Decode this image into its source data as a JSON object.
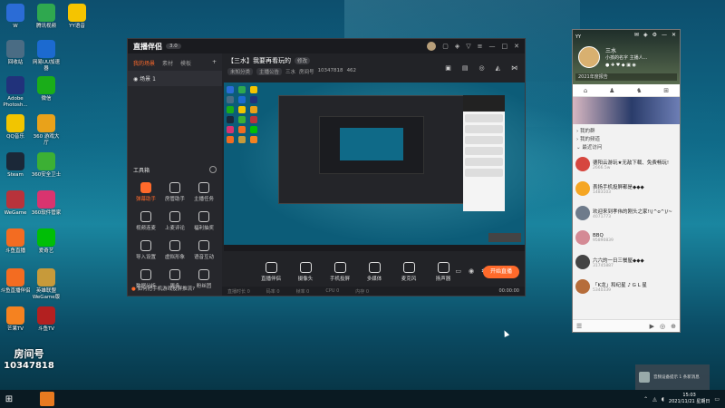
{
  "desktop": {
    "icons": [
      {
        "label": "W",
        "color": "#2b6cd6"
      },
      {
        "label": "腾讯视频",
        "color": "#2fa84f"
      },
      {
        "label": "YY语音",
        "color": "#f5c400"
      },
      {
        "label": "回收站",
        "color": "#4a6c84"
      },
      {
        "label": "网易UU加速器",
        "color": "#1c6ad0"
      },
      {
        "label": "Adobe Photosh...",
        "color": "#21327b"
      },
      {
        "label": "微信",
        "color": "#1aad19"
      },
      {
        "label": "QQ音乐",
        "color": "#f2c500"
      },
      {
        "label": "360 游戏大厅",
        "color": "#e9a21a"
      },
      {
        "label": "Steam",
        "color": "#1b2838"
      },
      {
        "label": "360安全卫士",
        "color": "#3cb034"
      },
      {
        "label": "WeGame",
        "color": "#b8333b"
      },
      {
        "label": "360软件管家",
        "color": "#d9346f"
      },
      {
        "label": "斗鱼直播",
        "color": "#f36c21"
      },
      {
        "label": "爱奇艺",
        "color": "#00be06"
      },
      {
        "label": "斗鱼直播伴侣",
        "color": "#f36c21"
      },
      {
        "label": "英雄联盟 WeGame版",
        "color": "#c79a3a"
      },
      {
        "label": "芒果TV",
        "color": "#f58220"
      },
      {
        "label": "斗鱼TV",
        "color": "#b32020"
      }
    ],
    "room_label": "房间号",
    "room_number": "10347818"
  },
  "app": {
    "logo": "直播伴侣",
    "version": "3.0",
    "sidebar": {
      "tabs": [
        "我的场景",
        "素材",
        "模板"
      ],
      "plus": "+",
      "scene": "场景 1",
      "tools_title": "工具箱",
      "tools": [
        {
          "label": "弹幕助手",
          "hot": true
        },
        {
          "label": "房管助手",
          "hot": false
        },
        {
          "label": "主播任务",
          "hot": false
        },
        {
          "label": "视频连麦",
          "hot": false
        },
        {
          "label": "上麦评论",
          "hot": false
        },
        {
          "label": "福利抽奖",
          "hot": false
        },
        {
          "label": "导入设置",
          "hot": false
        },
        {
          "label": "虚拟形象",
          "hot": false
        },
        {
          "label": "语音互动",
          "hot": false
        },
        {
          "label": "数据分析",
          "hot": false
        },
        {
          "label": "更多",
          "hot": false
        },
        {
          "label": "粉丝团",
          "hot": false
        }
      ],
      "tip": "如何把手机游戏投屏推流?"
    },
    "main": {
      "title": "【三水】我要再看玩的",
      "edit_label": "修改",
      "tags": [
        "未知分类",
        "主播公告",
        "三水",
        "房间号"
      ],
      "room_no": "10347818",
      "viewers": "462",
      "controls": [
        {
          "label": "直播伴侣"
        },
        {
          "label": "摄像头"
        },
        {
          "label": "手机投屏"
        },
        {
          "label": "多媒体"
        },
        {
          "label": "麦克风"
        },
        {
          "label": "扬声器"
        }
      ],
      "live_button": "开始直播",
      "status": [
        "直播时长 0",
        "码率 0",
        "帧率 0",
        "CPU 0",
        "内存 0"
      ],
      "time": "00:00:00"
    }
  },
  "chat_panel": {
    "app_tag": "YY",
    "name": "三水",
    "signature": "小孩的名字 主播人...",
    "search_placeholder": "2021年度报告",
    "groups": [
      "我的群",
      "我的频道",
      "最近访问"
    ],
    "contacts": [
      {
        "name": "德阳云游玩★无敌下载、免费畅玩!",
        "sub": "2666.5w",
        "color": "#d6473f"
      },
      {
        "name": "表扬手机投屏都是◆◆◆",
        "sub": "1483103",
        "color": "#f5a623"
      },
      {
        "name": "欢迎来到孝伟的刚头之家!\\(^o^)/~",
        "sub": "4071773",
        "color": "#6e7b8b"
      },
      {
        "name": "BBQ",
        "sub": "95890839",
        "color": "#d48a95"
      },
      {
        "name": "六六的一日三餐屋◆◆◆",
        "sub": "31745887",
        "color": "#444"
      },
      {
        "name": "「K龙」和纪星 ♪ G L 星",
        "sub": "5340339",
        "color": "#b66d3a"
      }
    ]
  },
  "notification": {
    "text": "音频设备提示 1 条新消息"
  },
  "taskbar": {
    "time": "15:03",
    "date": "2021/11/21 星期日"
  },
  "colors": {
    "accent": "#ff6a2b",
    "app_bg": "#222327",
    "taskbar": "#0a1a22"
  }
}
